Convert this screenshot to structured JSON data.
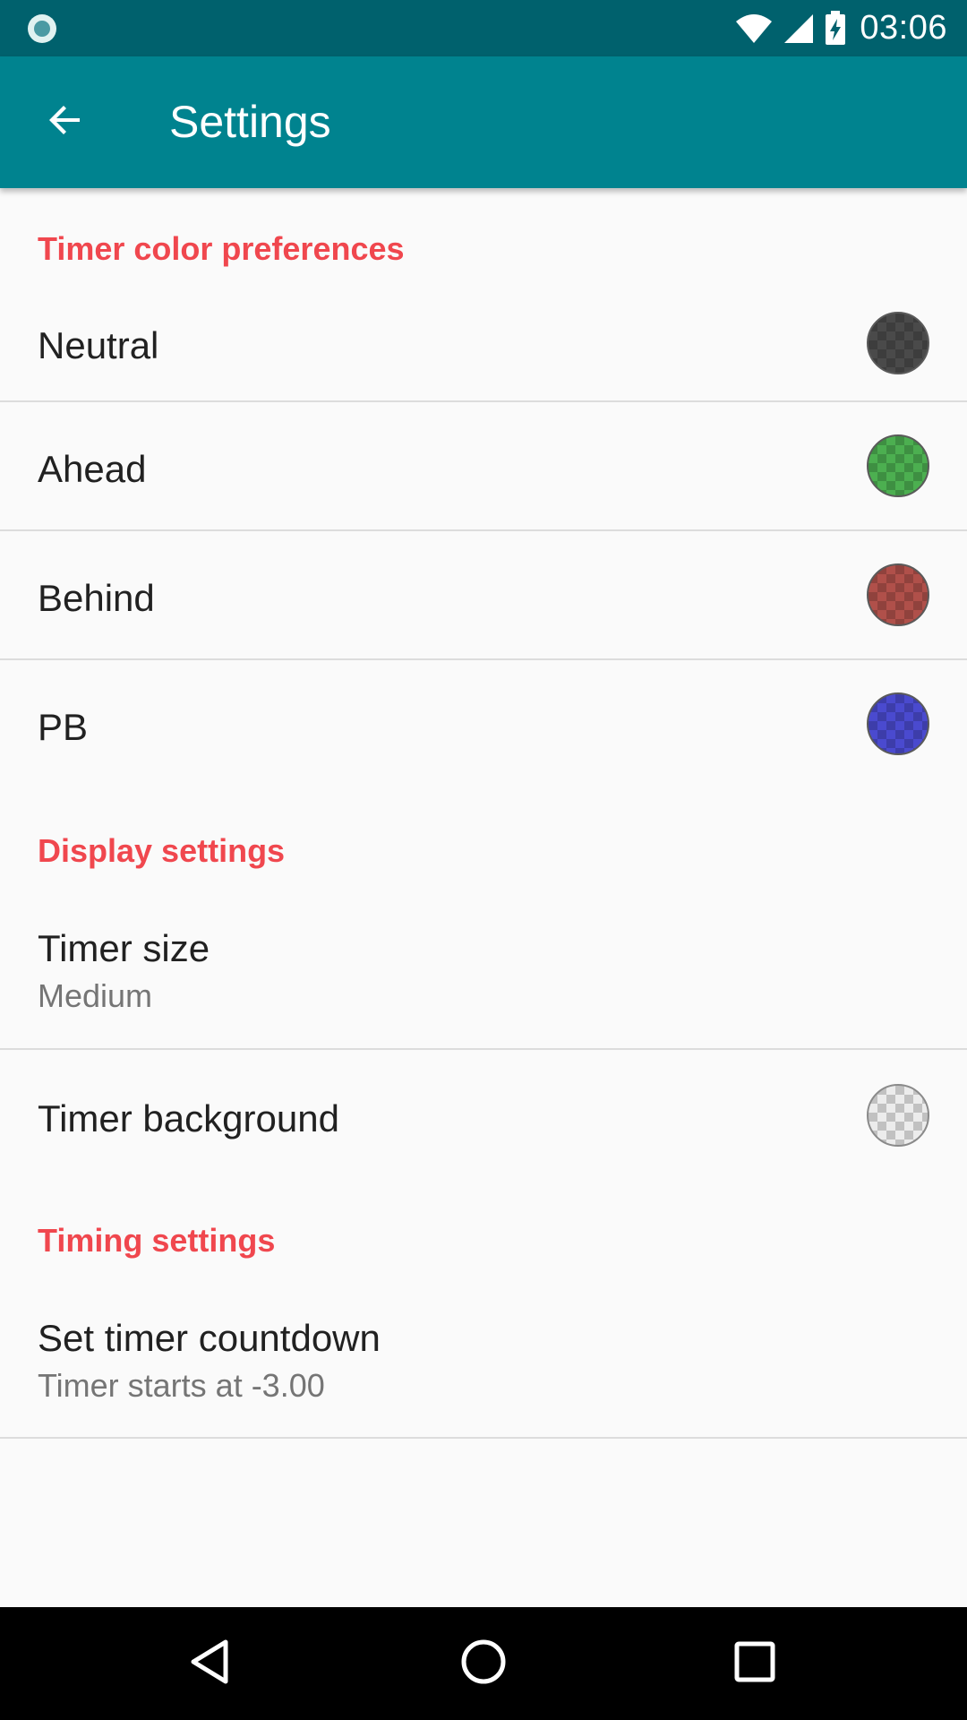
{
  "status_bar": {
    "time": "03:06",
    "icons": [
      "record-icon",
      "wifi-icon",
      "signal-icon",
      "battery-charging-icon"
    ]
  },
  "app_bar": {
    "title": "Settings",
    "back_icon": "arrow-back-icon"
  },
  "sections": {
    "timer_colors": {
      "header": "Timer color preferences",
      "items": [
        {
          "label": "Neutral",
          "color": "#4a4a4a"
        },
        {
          "label": "Ahead",
          "color": "#4caf50"
        },
        {
          "label": "Behind",
          "color": "#b0504a"
        },
        {
          "label": "PB",
          "color": "#4a4acf"
        }
      ]
    },
    "display": {
      "header": "Display settings",
      "timer_size": {
        "label": "Timer size",
        "summary": "Medium"
      },
      "timer_background": {
        "label": "Timer background",
        "color": "transparent"
      }
    },
    "timing": {
      "header": "Timing settings",
      "countdown": {
        "label": "Set timer countdown",
        "summary": "Timer starts at -3.00"
      }
    }
  },
  "nav_bar": {
    "icons": [
      "back-triangle-icon",
      "home-circle-icon",
      "recents-square-icon"
    ]
  },
  "colors": {
    "accent": "#f0474e",
    "primary": "#00838f",
    "primary_dark": "#00616d"
  }
}
